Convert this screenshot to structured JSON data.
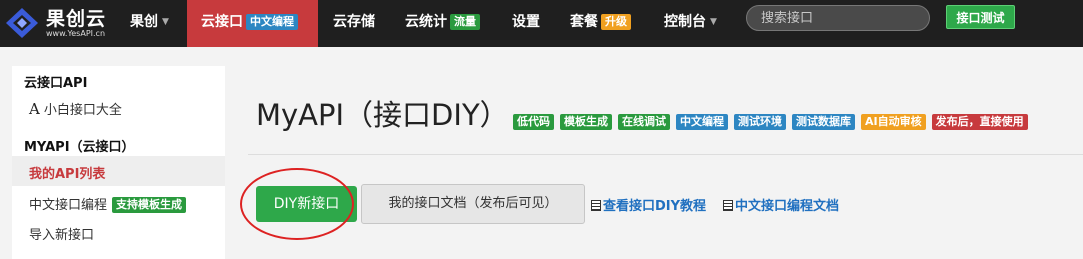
{
  "brand": {
    "title": "果创云",
    "subtitle": "www.YesAPI.cn"
  },
  "nav": {
    "guochuang": "果创",
    "yun_api": "云接口",
    "yun_api_tag": "中文编程",
    "storage": "云存储",
    "stats": "云统计",
    "stats_tag": "流量",
    "settings": "设置",
    "plan": "套餐",
    "plan_tag": "升级",
    "console": "控制台"
  },
  "search": {
    "placeholder": "搜索接口"
  },
  "test_button": "接口测试",
  "sidebar": {
    "section1": "云接口API",
    "item_all": "小白接口大全",
    "item_all_icon": "A",
    "section2": "MYAPI（云接口）",
    "active_item": "我的API列表",
    "item_chinese": "中文接口编程",
    "item_chinese_tag": "支持模板生成",
    "item_import": "导入新接口"
  },
  "main": {
    "title": "MyAPI（接口DIY）",
    "badges": [
      {
        "label": "低代码",
        "color": "#2a9a3e"
      },
      {
        "label": "模板生成",
        "color": "#2a9a3e"
      },
      {
        "label": "在线调试",
        "color": "#2a9a3e"
      },
      {
        "label": "中文编程",
        "color": "#2d86c2"
      },
      {
        "label": "测试环境",
        "color": "#2d86c2"
      },
      {
        "label": "测试数据库",
        "color": "#2d86c2"
      },
      {
        "label": "AI自动审核",
        "color": "#f0a020"
      },
      {
        "label": "发布后，直接使用",
        "color": "#c73a3d"
      }
    ],
    "diy_button": "DIY新接口",
    "doc_button": "我的接口文档（发布后可见）",
    "link_tutorial": "查看接口DIY教程",
    "link_chinese_doc": "中文接口编程文档"
  },
  "colors": {
    "nav_active": "#c73a3d",
    "green": "#2ea84a",
    "link": "#2070c0"
  }
}
